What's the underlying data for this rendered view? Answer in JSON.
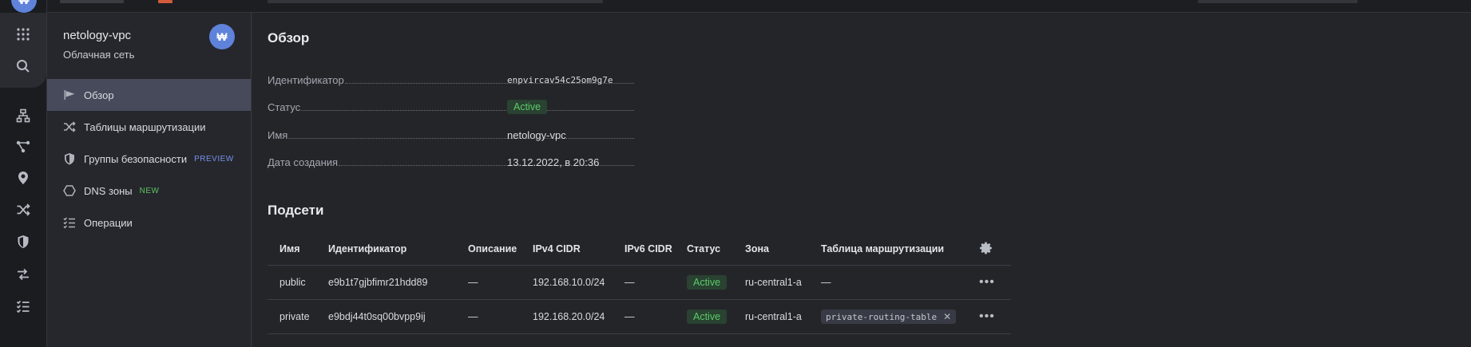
{
  "rail": {
    "brand_initial": "₩",
    "icons": [
      "brand-logo-icon",
      "apps-grid-icon",
      "search-icon",
      "topology-icon",
      "network-graph-icon",
      "location-pin-icon",
      "shuffle-icon",
      "shield-icon",
      "transfer-icon",
      "checklist-icon"
    ]
  },
  "sidebar": {
    "title": "netology-vpc",
    "subtitle": "Облачная сеть",
    "badge_initial": "₩",
    "items": [
      {
        "label": "Обзор",
        "icon": "flag-icon",
        "active": true
      },
      {
        "label": "Таблицы маршрутизации",
        "icon": "shuffle-icon"
      },
      {
        "label": "Группы безопасности",
        "icon": "shield-icon",
        "tag": "PREVIEW"
      },
      {
        "label": "DNS зоны",
        "icon": "hexagon-icon",
        "tag": "NEW"
      },
      {
        "label": "Операции",
        "icon": "checklist-icon"
      }
    ]
  },
  "overview": {
    "heading": "Обзор",
    "fields": [
      {
        "key": "Идентификатор",
        "value": "enpvircav54c25om9g7e"
      },
      {
        "key": "Статус",
        "value": "Active"
      },
      {
        "key": "Имя",
        "value": "netology-vpc"
      },
      {
        "key": "Дата создания",
        "value": "13.12.2022, в 20:36"
      }
    ]
  },
  "subnets": {
    "heading": "Подсети",
    "columns": [
      "Имя",
      "Идентификатор",
      "Описание",
      "IPv4 CIDR",
      "IPv6 CIDR",
      "Статус",
      "Зона",
      "Таблица маршрутизации"
    ],
    "rows": [
      {
        "name": "public",
        "id": "e9b1t7gjbfimr21hdd89",
        "description": "—",
        "ipv4": "192.168.10.0/24",
        "ipv6": "—",
        "status": "Active",
        "zone": "ru-central1-a",
        "route_table": "—"
      },
      {
        "name": "private",
        "id": "e9bdj44t0sq00bvpp9ij",
        "description": "—",
        "ipv4": "192.168.20.0/24",
        "ipv6": "—",
        "status": "Active",
        "zone": "ru-central1-a",
        "route_table": "private-routing-table"
      }
    ],
    "more_glyph": "•••",
    "remove_glyph": "✕"
  },
  "colors": {
    "active_status": "#5ccb69",
    "accent": "#5f82da",
    "preview_tag": "#7591ea",
    "new_tag": "#5cc462"
  }
}
